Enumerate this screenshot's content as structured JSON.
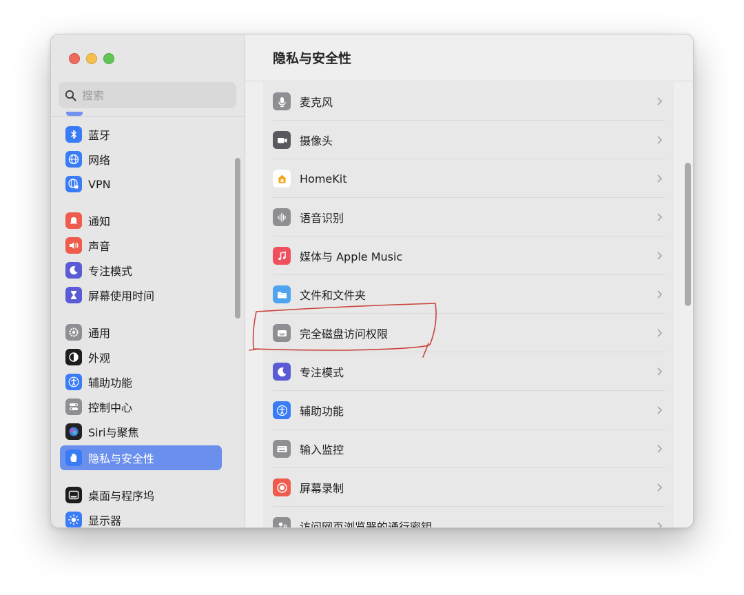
{
  "window": {
    "title": "隐私与安全性"
  },
  "search": {
    "placeholder": "搜索"
  },
  "sidebar": {
    "items": [
      {
        "label": "蓝牙",
        "icon": "bluetooth-icon",
        "color": "#3a7cf5"
      },
      {
        "label": "网络",
        "icon": "globe-icon",
        "color": "#3a7cf5"
      },
      {
        "label": "VPN",
        "icon": "vpn-globe-icon",
        "color": "#3a7cf5"
      },
      {
        "label": "通知",
        "icon": "bell-icon",
        "color": "#ef5b4c"
      },
      {
        "label": "声音",
        "icon": "speaker-icon",
        "color": "#ef5b4c"
      },
      {
        "label": "专注模式",
        "icon": "moon-icon",
        "color": "#5b5bd6"
      },
      {
        "label": "屏幕使用时间",
        "icon": "hourglass-icon",
        "color": "#5b5bd6"
      },
      {
        "label": "通用",
        "icon": "gear-icon",
        "color": "#8e8e93"
      },
      {
        "label": "外观",
        "icon": "appearance-icon",
        "color": "#1d1d1f"
      },
      {
        "label": "辅助功能",
        "icon": "accessibility-icon",
        "color": "#3a7cf5"
      },
      {
        "label": "控制中心",
        "icon": "toggles-icon",
        "color": "#8e8e93"
      },
      {
        "label": "Siri与聚焦",
        "icon": "siri-icon",
        "color": "#222222"
      },
      {
        "label": "隐私与安全性",
        "icon": "hand-icon",
        "color": "#3a7cf5",
        "selected": true
      },
      {
        "label": "桌面与程序坞",
        "icon": "dock-icon",
        "color": "#1d1d1f"
      },
      {
        "label": "显示器",
        "icon": "sun-icon",
        "color": "#3a7cf5"
      }
    ]
  },
  "main": {
    "rows": [
      {
        "label": "麦克风",
        "icon": "microphone-icon",
        "color": "#8e8e93"
      },
      {
        "label": "摄像头",
        "icon": "camera-icon",
        "color": "#5a5a5e"
      },
      {
        "label": "HomeKit",
        "icon": "home-icon",
        "color": "#ffffff"
      },
      {
        "label": "语音识别",
        "icon": "waveform-icon",
        "color": "#8e8e93"
      },
      {
        "label": "媒体与 Apple Music",
        "icon": "music-note-icon",
        "color": "#f0505e"
      },
      {
        "label": "文件和文件夹",
        "icon": "folder-icon",
        "color": "#4fa3ef"
      },
      {
        "label": "完全磁盘访问权限",
        "icon": "disk-icon",
        "color": "#8e8e93"
      },
      {
        "label": "专注模式",
        "icon": "moon-icon",
        "color": "#5b5bd6"
      },
      {
        "label": "辅助功能",
        "icon": "accessibility-icon",
        "color": "#3a7cf5"
      },
      {
        "label": "输入监控",
        "icon": "keyboard-icon",
        "color": "#8e8e93"
      },
      {
        "label": "屏幕录制",
        "icon": "record-icon",
        "color": "#ef5b4c"
      },
      {
        "label": "访问网页浏览器的通行密钥",
        "icon": "person-key-icon",
        "color": "#8e8e93"
      }
    ]
  }
}
